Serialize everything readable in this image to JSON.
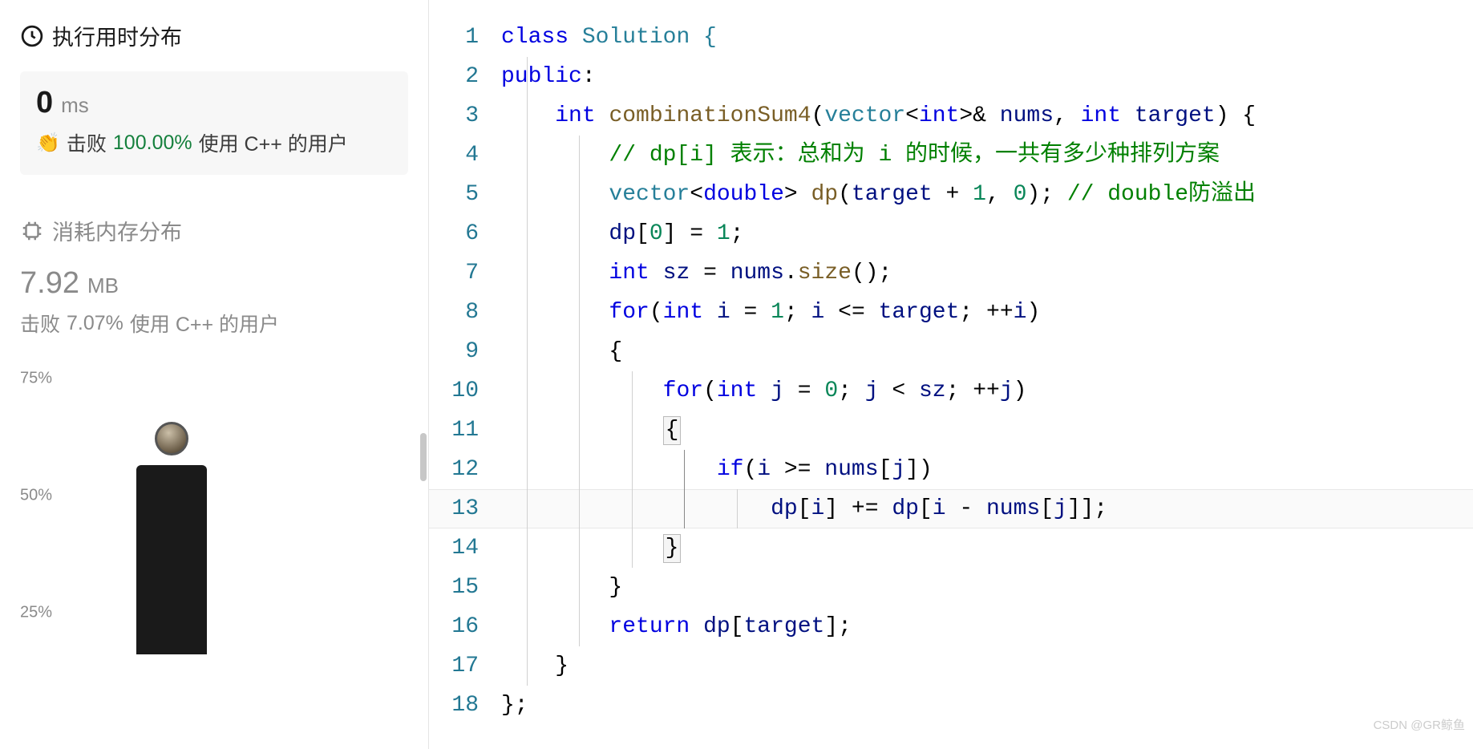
{
  "left": {
    "runtime": {
      "title": "执行用时分布",
      "value": "0",
      "unit": "ms",
      "beat_label": "击败",
      "beat_pct": "100.00%",
      "beat_suffix": "使用 C++ 的用户"
    },
    "memory": {
      "title": "消耗内存分布",
      "value": "7.92",
      "unit": "MB",
      "beat_label": "击败",
      "beat_pct": "7.07%",
      "beat_suffix": "使用 C++ 的用户"
    },
    "chart": {
      "y_labels": [
        "75%",
        "50%",
        "25%"
      ]
    }
  },
  "code": {
    "lines": [
      "1",
      "2",
      "3",
      "4",
      "5",
      "6",
      "7",
      "8",
      "9",
      "10",
      "11",
      "12",
      "13",
      "14",
      "15",
      "16",
      "17",
      "18"
    ],
    "tokens": {
      "l1": {
        "a": "class",
        "b": " Solution {"
      },
      "l2": {
        "a": "public",
        "b": ":"
      },
      "l3": {
        "a": "int",
        "b": "combinationSum4",
        "c": "vector",
        "d": "int",
        "e": "nums",
        "f": "int",
        "g": "target"
      },
      "l4": {
        "a": "// dp[i] 表示：总和为 i 的时候，一共有多少种排列方案"
      },
      "l5": {
        "a": "vector",
        "b": "double",
        "c": "dp",
        "d": "target",
        "e": "1",
        "f": "0",
        "g": "// double防溢出"
      },
      "l6": {
        "a": "dp",
        "b": "0",
        "c": "1"
      },
      "l7": {
        "a": "int",
        "b": "sz",
        "c": "nums",
        "d": "size"
      },
      "l8": {
        "a": "for",
        "b": "int",
        "c": "i",
        "d": "1",
        "e": "i",
        "f": "target",
        "g": "i"
      },
      "l10": {
        "a": "for",
        "b": "int",
        "c": "j",
        "d": "0",
        "e": "j",
        "f": "sz",
        "g": "j"
      },
      "l12": {
        "a": "if",
        "b": "i",
        "c": "nums",
        "d": "j"
      },
      "l13": {
        "a": "dp",
        "b": "i",
        "c": "dp",
        "d": "i",
        "e": "nums",
        "f": "j"
      },
      "l16": {
        "a": "return",
        "b": "dp",
        "c": "target"
      }
    }
  },
  "watermark": "CSDN @GR鲸鱼"
}
